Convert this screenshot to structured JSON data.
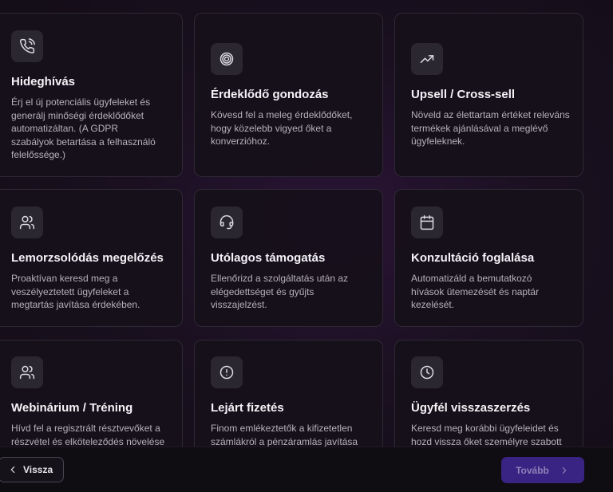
{
  "cards": [
    {
      "title": "Hideghívás",
      "icon": "phone-icon",
      "desc": "Érj el új potenciális ügyfeleket és generálj minőségi érdeklődőket automatizáltan. (A GDPR szabályok betartása a felhasználó felelőssége.)"
    },
    {
      "title": "Érdeklődő gondozás",
      "icon": "target-icon",
      "desc": "Kövesd fel a meleg érdeklődőket, hogy közelebb vigyed őket a konverzióhoz."
    },
    {
      "title": "Upsell / Cross-sell",
      "icon": "trending-up-icon",
      "desc": "Növeld az élettartam értéket releváns termékek ajánlásával a meglévő ügyfeleknek."
    },
    {
      "title": "Lemorzsolódás megelőzés",
      "icon": "users-icon",
      "desc": "Proaktívan keresd meg a veszélyeztetett ügyfeleket a megtartás javítása érdekében."
    },
    {
      "title": "Utólagos támogatás",
      "icon": "headset-icon",
      "desc": "Ellenőrizd a szolgáltatás után az elégedettséget és gyűjts visszajelzést."
    },
    {
      "title": "Konzultáció foglalása",
      "icon": "calendar-icon",
      "desc": "Automatizáld a bemutatkozó hívások ütemezését és naptár kezelését."
    },
    {
      "title": "Webinárium / Tréning",
      "icon": "users-icon",
      "desc": "Hívd fel a regisztrált résztvevőket a részvétel és elköteleződés növelése"
    },
    {
      "title": "Lejárt fizetés",
      "icon": "alert-circle-icon",
      "desc": "Finom emlékeztetők a kifizetetlen számlákról a pénzáramlás javítása"
    },
    {
      "title": "Ügyfél visszaszerzés",
      "icon": "clock-icon",
      "desc": "Keresd meg korábbi ügyfeleidet és hozd vissza őket személyre szabott"
    }
  ],
  "footer": {
    "back_label": "Vissza",
    "next_label": "Tovább"
  },
  "colors": {
    "next_button_bg": "#3a2483",
    "card_border": "#2e2834"
  }
}
